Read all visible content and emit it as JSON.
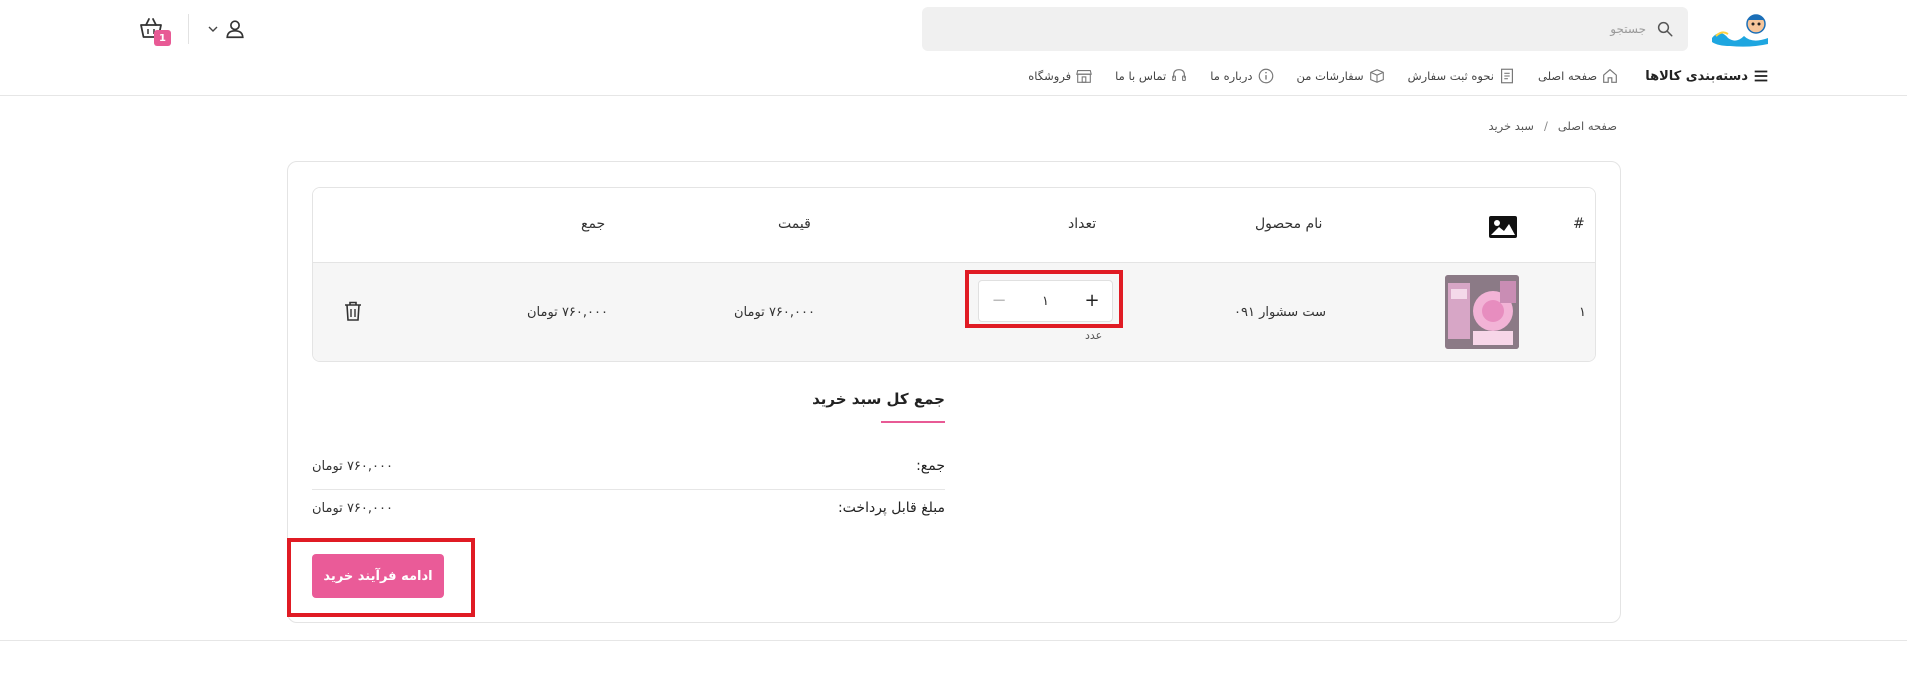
{
  "header": {
    "search_placeholder": "جستجو",
    "cart_count": "1",
    "accent_color": "#e85a95"
  },
  "nav": {
    "categories": "دسته‌بندی کالاها",
    "items": [
      {
        "label": "صفحه اصلی",
        "icon": "home-icon"
      },
      {
        "label": "نحوه ثبت سفارش",
        "icon": "document-icon"
      },
      {
        "label": "سفارشات من",
        "icon": "box-icon"
      },
      {
        "label": "درباره ما",
        "icon": "info-icon"
      },
      {
        "label": "تماس با ما",
        "icon": "headset-icon"
      },
      {
        "label": "فروشگاه",
        "icon": "store-icon"
      }
    ]
  },
  "breadcrumb": {
    "home": "صفحه اصلی",
    "separator": "/",
    "current": "سبد خرید"
  },
  "cart_table": {
    "headers": {
      "index": "#",
      "image": "image-icon",
      "name": "نام محصول",
      "quantity": "تعداد",
      "price": "قیمت",
      "total": "جمع"
    },
    "rows": [
      {
        "index": "۱",
        "name": "ست سشوار ۰۹۱",
        "quantity": "۱",
        "unit": "عدد",
        "price": "۷۶۰,۰۰۰ تومان",
        "total": "۷۶۰,۰۰۰ تومان"
      }
    ]
  },
  "totals": {
    "title": "جمع کل سبد خرید",
    "sum_label": "جمع:",
    "sum_value": "۷۶۰,۰۰۰ تومان",
    "payable_label": "مبلغ قابل پرداخت:",
    "payable_value": "۷۶۰,۰۰۰ تومان"
  },
  "checkout": {
    "label": "ادامه فرآیند خرید"
  }
}
